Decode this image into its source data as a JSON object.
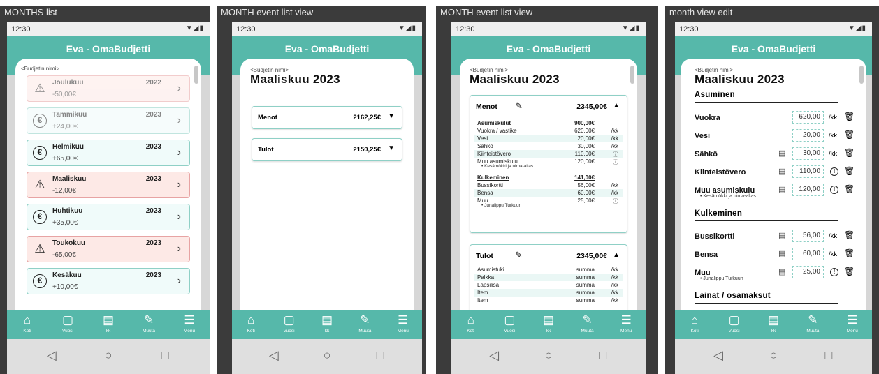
{
  "app_title": "Eva - OmaBudjetti",
  "status_time": "12:30",
  "budget_name": "<Budjetin nimi>",
  "tabs": [
    {
      "icon": "home-icon",
      "label": "Koti"
    },
    {
      "icon": "year-icon",
      "label": "Vuosi"
    },
    {
      "icon": "calendar-icon",
      "label": "kk"
    },
    {
      "icon": "edit-icon",
      "label": "Muuta"
    },
    {
      "icon": "menu-icon",
      "label": "Menu"
    }
  ],
  "frames": {
    "months_list": "MONTHS list",
    "event_view_1": "MONTH event list view",
    "event_view_2": "MONTH event list view",
    "month_edit": "month view edit"
  },
  "months": [
    {
      "name": "Joulukuu",
      "amount": "-50,00€",
      "year": "2022",
      "status": "warn",
      "faded": true
    },
    {
      "name": "Tammikuu",
      "amount": "+24,00€",
      "year": "2023",
      "status": "ok",
      "faded": true
    },
    {
      "name": "Helmikuu",
      "amount": "+65,00€",
      "year": "2023",
      "status": "ok",
      "faded": false
    },
    {
      "name": "Maaliskuu",
      "amount": "-12,00€",
      "year": "2023",
      "status": "warn",
      "faded": false
    },
    {
      "name": "Huhtikuu",
      "amount": "+35,00€",
      "year": "2023",
      "status": "ok",
      "faded": false
    },
    {
      "name": "Toukokuu",
      "amount": "-65,00€",
      "year": "2023",
      "status": "warn",
      "faded": false
    },
    {
      "name": "Kesäkuu",
      "amount": "+10,00€",
      "year": "2023",
      "status": "ok",
      "faded": false
    }
  ],
  "month_title": "Maaliskuu 2023",
  "collapsed": {
    "menot_label": "Menot",
    "menot_total": "2162,25€",
    "tulot_label": "Tulot",
    "tulot_total": "2150,25€"
  },
  "expanded": {
    "menot_label": "Menot",
    "menot_total": "2345,00€",
    "asumiskulut": "Asumiskulut",
    "asumiskulut_total": "900,00€",
    "housing": [
      {
        "label": "Vuokra / vastike",
        "value": "620,00€",
        "unit": "/kk"
      },
      {
        "label": "Vesi",
        "value": "20,00€",
        "unit": "/kk"
      },
      {
        "label": "Sähkö",
        "value": "30,00€",
        "unit": "/kk"
      },
      {
        "label": "Kiinteistövero",
        "value": "110,00€",
        "unit": "!"
      },
      {
        "label": "Muu asumiskulu",
        "value": "120,00€",
        "unit": "!"
      }
    ],
    "housing_note": "Kesämökki ja uima-allas",
    "kulkeminen": "Kulkeminen",
    "kulkeminen_total": "141,00€",
    "transport": [
      {
        "label": "Bussikortti",
        "value": "56,00€",
        "unit": "/kk"
      },
      {
        "label": "Bensa",
        "value": "60,00€",
        "unit": "/kk"
      },
      {
        "label": "Muu",
        "value": "25,00€",
        "unit": "!"
      }
    ],
    "transport_note": "Junalippu Turkuun",
    "tulot_label": "Tulot",
    "tulot_total": "2345,00€",
    "income": [
      {
        "label": "Asumistuki",
        "value": "summa",
        "unit": "/kk"
      },
      {
        "label": "Palkka",
        "value": "summa",
        "unit": "/kk"
      },
      {
        "label": "Lapsilisä",
        "value": "summa",
        "unit": "/kk"
      },
      {
        "label": "Item",
        "value": "summa",
        "unit": "/kk"
      },
      {
        "label": "Item",
        "value": "summa",
        "unit": "/kk"
      }
    ]
  },
  "edit": {
    "asuminen": "Asuminen",
    "housing": [
      {
        "label": "Vuokra",
        "value": "620,00",
        "calendar": false,
        "alert": false
      },
      {
        "label": "Vesi",
        "value": "20,00",
        "calendar": false,
        "alert": false
      },
      {
        "label": "Sähkö",
        "value": "30,00",
        "calendar": true,
        "alert": false
      },
      {
        "label": "Kiinteistövero",
        "value": "110,00",
        "calendar": true,
        "alert": true
      },
      {
        "label": "Muu asumiskulu",
        "value": "120,00",
        "calendar": true,
        "alert": true
      }
    ],
    "housing_note": "Kesämökki ja uima-allas",
    "kulkeminen": "Kulkeminen",
    "transport": [
      {
        "label": "Bussikortti",
        "value": "56,00",
        "calendar": true,
        "alert": false
      },
      {
        "label": "Bensa",
        "value": "60,00",
        "calendar": true,
        "alert": false
      },
      {
        "label": "Muu",
        "value": "25,00",
        "calendar": true,
        "alert": true
      }
    ],
    "transport_note": "Junalippu Turkuun",
    "lainat": "Lainat / osamaksut",
    "unit": "/kk"
  }
}
